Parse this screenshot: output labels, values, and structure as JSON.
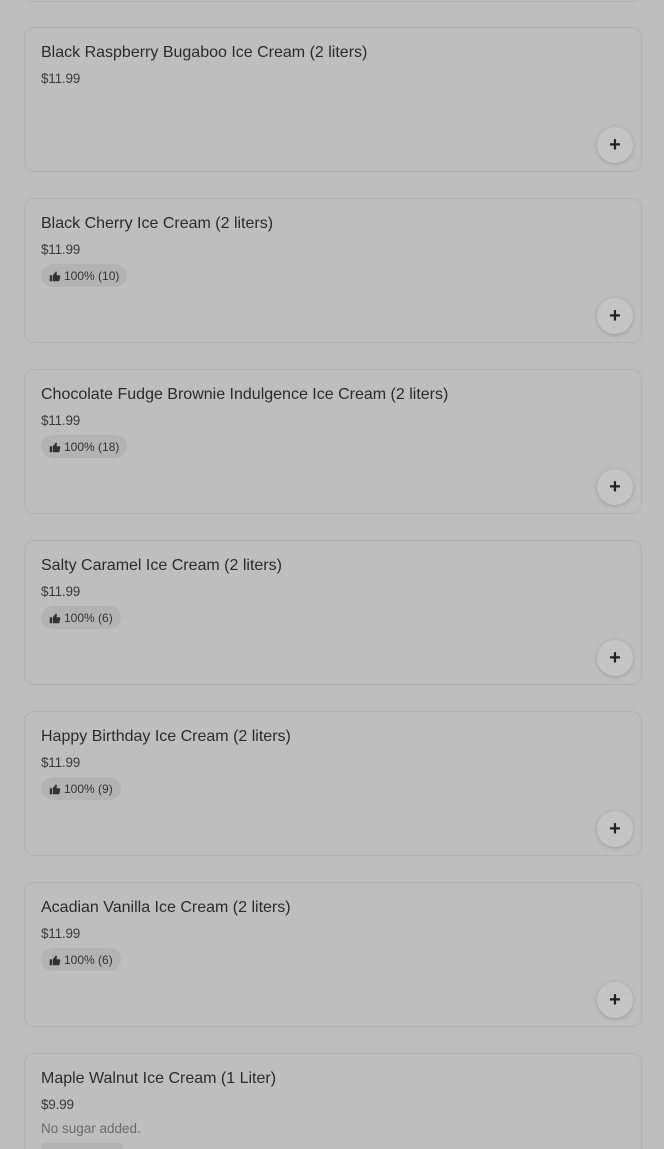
{
  "items": [
    {
      "name": "Black Raspberry Bugaboo Ice Cream (2 liters)",
      "price": "$11.99",
      "rating": "",
      "description": ""
    },
    {
      "name": "Black Cherry Ice Cream (2 liters)",
      "price": "$11.99",
      "rating": "100% (10)",
      "description": ""
    },
    {
      "name": "Chocolate Fudge Brownie Indulgence Ice Cream (2 liters)",
      "price": "$11.99",
      "rating": "100% (18)",
      "description": ""
    },
    {
      "name": "Salty Caramel Ice Cream (2 liters)",
      "price": "$11.99",
      "rating": "100% (6)",
      "description": ""
    },
    {
      "name": "Happy Birthday Ice Cream (2 liters)",
      "price": "$11.99",
      "rating": "100% (9)",
      "description": ""
    },
    {
      "name": "Acadian Vanilla Ice Cream (2 liters)",
      "price": "$11.99",
      "rating": "100% (6)",
      "description": ""
    },
    {
      "name": "Maple Walnut Ice Cream (1 Liter)",
      "price": "$9.99",
      "rating": "",
      "description": "No sugar added."
    }
  ],
  "icons": {
    "add": "plus-icon",
    "rating": "thumbs-up-icon"
  },
  "colors": {
    "overlay_background": "#bebebe",
    "card_border": "#b3b3b3",
    "text_primary": "#2b2b2b"
  }
}
